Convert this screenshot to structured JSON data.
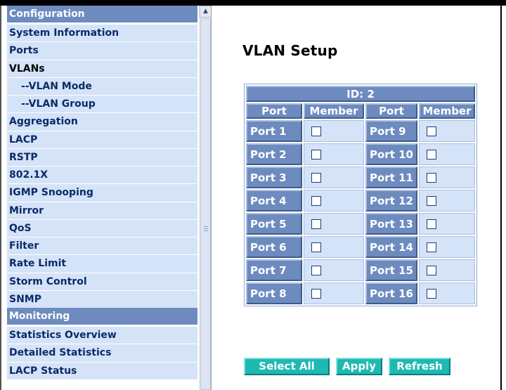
{
  "sidebar": {
    "items": [
      {
        "label": "Configuration",
        "kind": "header"
      },
      {
        "label": "System Information",
        "kind": "item"
      },
      {
        "label": "Ports",
        "kind": "item"
      },
      {
        "label": "VLANs",
        "kind": "item",
        "active": true
      },
      {
        "label": "--VLAN Mode",
        "kind": "sub"
      },
      {
        "label": "--VLAN Group",
        "kind": "sub"
      },
      {
        "label": "Aggregation",
        "kind": "item"
      },
      {
        "label": "LACP",
        "kind": "item"
      },
      {
        "label": "RSTP",
        "kind": "item"
      },
      {
        "label": "802.1X",
        "kind": "item"
      },
      {
        "label": "IGMP Snooping",
        "kind": "item"
      },
      {
        "label": "Mirror",
        "kind": "item"
      },
      {
        "label": "QoS",
        "kind": "item"
      },
      {
        "label": "Filter",
        "kind": "item"
      },
      {
        "label": "Rate Limit",
        "kind": "item"
      },
      {
        "label": "Storm Control",
        "kind": "item"
      },
      {
        "label": "SNMP",
        "kind": "item"
      },
      {
        "label": "Monitoring",
        "kind": "header"
      },
      {
        "label": "Statistics Overview",
        "kind": "item"
      },
      {
        "label": "Detailed Statistics",
        "kind": "item"
      },
      {
        "label": "LACP Status",
        "kind": "item"
      }
    ],
    "scrollbar": {
      "up_icon": "triangle-up"
    }
  },
  "main": {
    "title": "VLAN Setup",
    "table": {
      "id_label": "ID: 2",
      "headers": [
        "Port",
        "Member",
        "Port",
        "Member"
      ],
      "rows": [
        {
          "left": "Port 1",
          "right": "Port 9"
        },
        {
          "left": "Port 2",
          "right": "Port 10"
        },
        {
          "left": "Port 3",
          "right": "Port 11"
        },
        {
          "left": "Port 4",
          "right": "Port 12"
        },
        {
          "left": "Port 5",
          "right": "Port 13"
        },
        {
          "left": "Port 6",
          "right": "Port 14"
        },
        {
          "left": "Port 7",
          "right": "Port 15"
        },
        {
          "left": "Port 8",
          "right": "Port 16"
        }
      ],
      "members_checked": false
    },
    "buttons": {
      "select_all": "Select All",
      "apply": "Apply",
      "refresh": "Refresh"
    }
  },
  "colors": {
    "header_blue": "#6d8bbf",
    "item_bg": "#d4e3f8",
    "item_text": "#0b2a66",
    "button_teal": "#1fb9b4"
  }
}
